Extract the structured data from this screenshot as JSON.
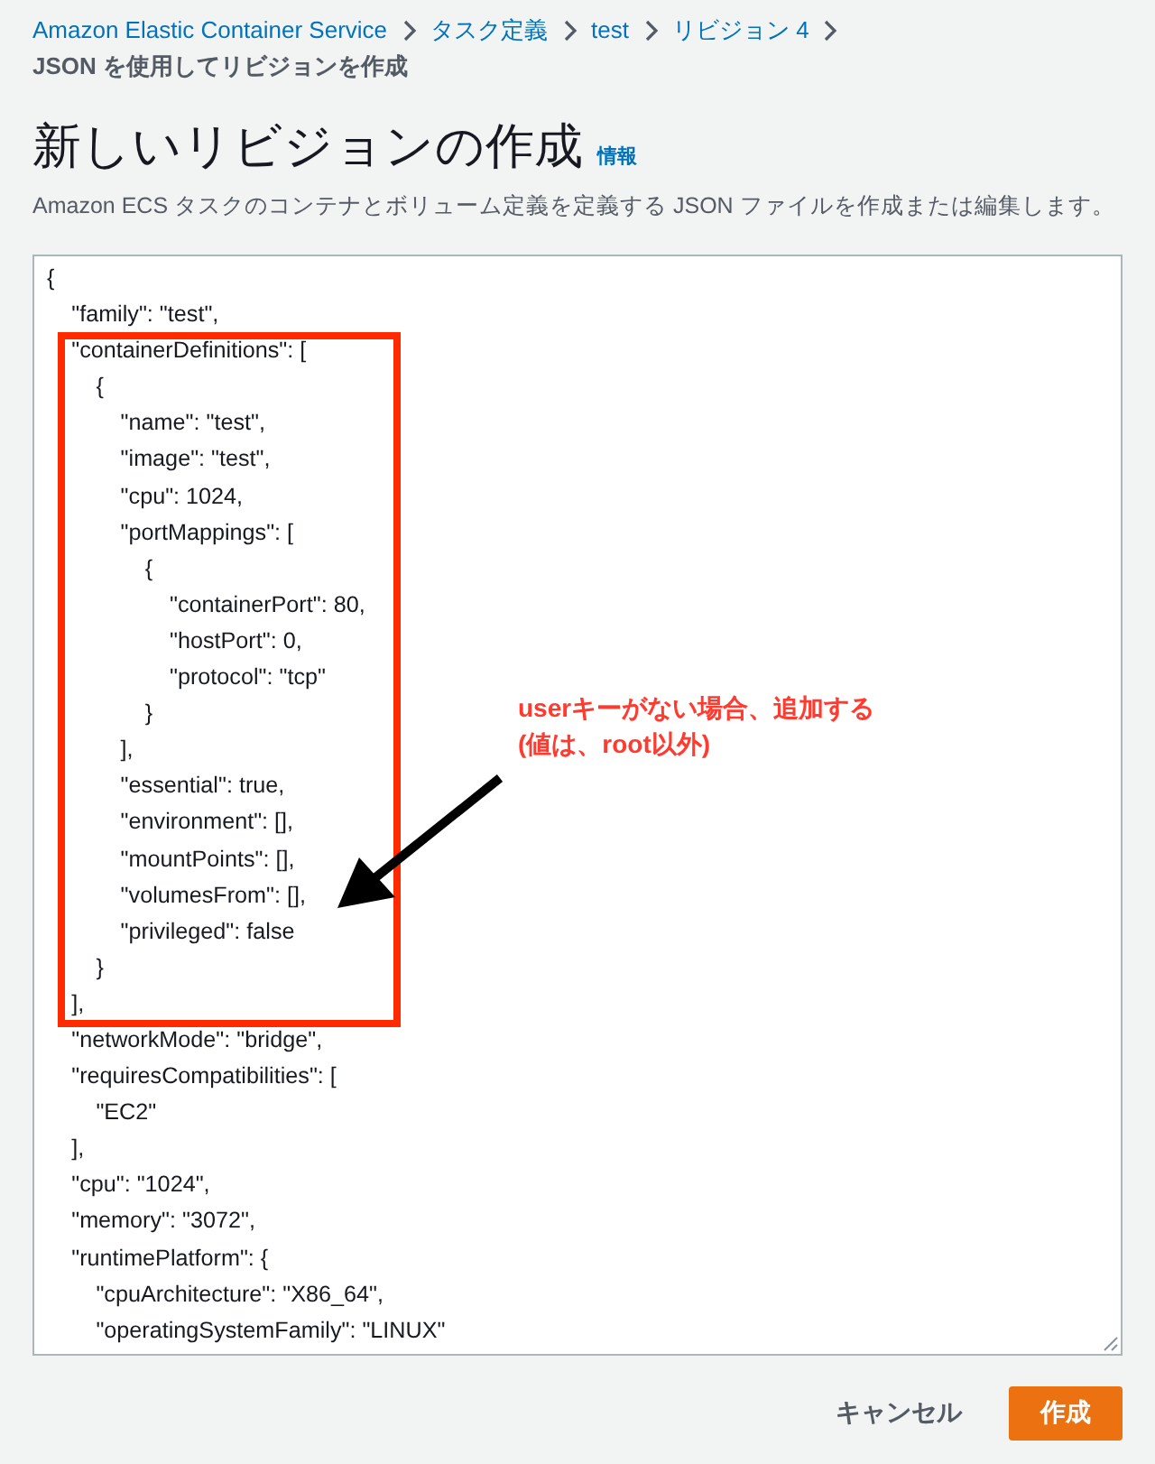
{
  "breadcrumbs": [
    {
      "label": "Amazon Elastic Container Service",
      "kind": "link"
    },
    {
      "label": "タスク定義",
      "kind": "link"
    },
    {
      "label": "test",
      "kind": "link"
    },
    {
      "label": "リビジョン 4",
      "kind": "link"
    },
    {
      "label": "JSON を使用してリビジョンを作成",
      "kind": "current"
    }
  ],
  "page": {
    "title": "新しいリビジョンの作成",
    "info_link": "情報",
    "description": "Amazon ECS タスクのコンテナとボリューム定義を定義する JSON ファイルを作成または編集します。"
  },
  "editor": {
    "lines": [
      {
        "text": "{",
        "children": [
          {
            "text": "\"family\": \"test\","
          },
          {
            "text": "\"containerDefinitions\": [",
            "children": [
              {
                "text": "{",
                "children": [
                  {
                    "text": "\"name\": \"test\","
                  },
                  {
                    "text": "\"image\": \"test\","
                  },
                  {
                    "text": "\"cpu\": 1024,"
                  },
                  {
                    "text": "\"portMappings\": [",
                    "children": [
                      {
                        "text": "{",
                        "children": [
                          {
                            "text": "\"containerPort\": 80,"
                          },
                          {
                            "text": "\"hostPort\": 0,"
                          },
                          {
                            "text": "\"protocol\": \"tcp\""
                          }
                        ]
                      },
                      {
                        "text": "}"
                      }
                    ]
                  },
                  {
                    "text": "],"
                  },
                  {
                    "text": "\"essential\": true,"
                  },
                  {
                    "text": "\"environment\": [],"
                  },
                  {
                    "text": "\"mountPoints\": [],"
                  },
                  {
                    "text": "\"volumesFrom\": [],"
                  },
                  {
                    "text": "\"privileged\": false"
                  }
                ]
              },
              {
                "text": "}"
              }
            ]
          },
          {
            "text": "],"
          },
          {
            "text": "\"networkMode\": \"bridge\","
          },
          {
            "text": "\"requiresCompatibilities\": [",
            "children": [
              {
                "text": "\"EC2\""
              }
            ]
          },
          {
            "text": "],"
          },
          {
            "text": "\"cpu\": \"1024\","
          },
          {
            "text": "\"memory\": \"3072\","
          },
          {
            "text": "\"runtimePlatform\": {",
            "children": [
              {
                "text": "\"cpuArchitecture\": \"X86_64\","
              },
              {
                "text": "\"operatingSystemFamily\": \"LINUX\""
              }
            ]
          }
        ]
      }
    ]
  },
  "annotation": {
    "lines": [
      "userキーがない場合、追加する",
      "(値は、root以外)"
    ]
  },
  "buttons": [
    {
      "label": "キャンセル",
      "kind": "link"
    },
    {
      "label": "作成",
      "kind": "primary"
    }
  ]
}
